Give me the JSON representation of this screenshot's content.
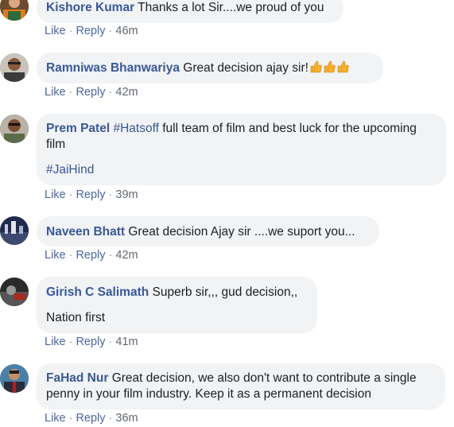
{
  "comments": [
    {
      "author": "Kishore Kumar",
      "text": "Thanks a lot Sir....we proud of you",
      "like": "Like",
      "reply": "Reply",
      "time": "46m",
      "avatar": "avatar"
    },
    {
      "author": "Ramniwas Bhanwariya",
      "text": "Great decision ajay sir!",
      "emoji": "thumbs-up-emoji",
      "like": "Like",
      "reply": "Reply",
      "time": "42m"
    },
    {
      "author": "Prem Patel",
      "hashtag1": "#Hatsoff",
      "text_a": " full team of film and best luck for the upcoming",
      "text_b": "film",
      "hashtag2": "#JaiHind",
      "like": "Like",
      "reply": "Reply",
      "time": "39m"
    },
    {
      "author": "Naveen Bhatt",
      "text": "Great decision Ajay sir ....we suport you...",
      "like": "Like",
      "reply": "Reply",
      "time": "42m"
    },
    {
      "author": "Girish C Salimath",
      "text": "Superb sir,,, gud decision,,",
      "text2": "Nation first",
      "like": "Like",
      "reply": "Reply",
      "time": "41m"
    },
    {
      "author": "FaHad Nur",
      "text_a": "Great decision, we also don't want to contribute a single",
      "text_b": "penny in your film industry. Keep it as a permanent decision",
      "like": "Like",
      "reply": "Reply",
      "time": "36m"
    }
  ],
  "separator": "·",
  "colors": {
    "author": "#385898",
    "bubble": "#f2f3f5",
    "meta": "#606770"
  }
}
